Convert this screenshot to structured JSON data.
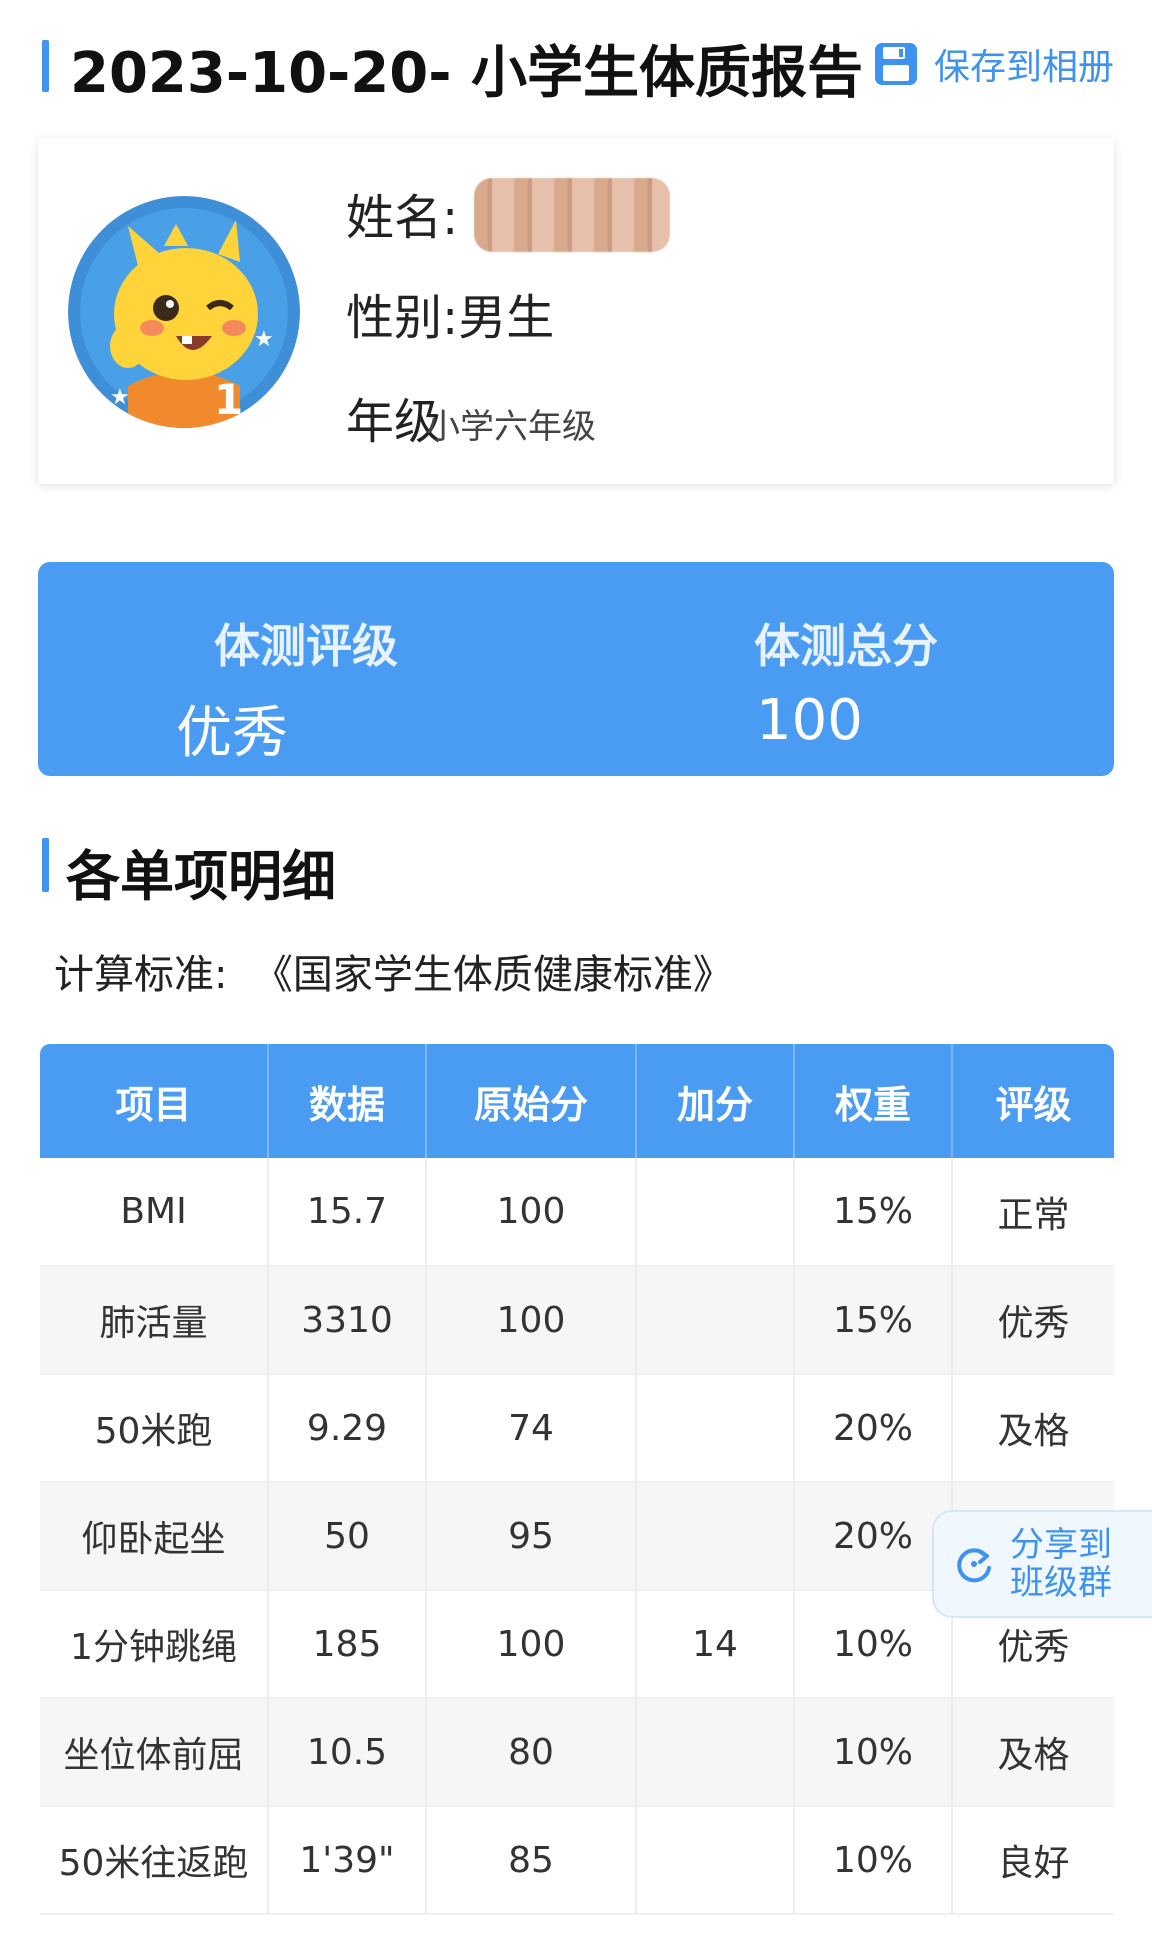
{
  "header": {
    "title": "2023-10-20- 小学生体质报告",
    "save_label": "保存到相册",
    "save_icon": "save-icon"
  },
  "profile": {
    "avatar_icon": "mascot-avatar",
    "name_label": "姓名:",
    "gender_label": "性别:",
    "gender_value": "男生",
    "grade_label": "年级",
    "grade_value": "小学六年级"
  },
  "score": {
    "rating_label": "体测评级",
    "rating_value": "优秀",
    "total_label": "体测总分",
    "total_value": "100"
  },
  "details": {
    "title": "各单项明细",
    "standard_label": "计算标准:",
    "standard_value": "《国家学生体质健康标准》",
    "columns": [
      "项目",
      "数据",
      "原始分",
      "加分",
      "权重",
      "评级"
    ],
    "rows": [
      [
        "BMI",
        "15.7",
        "100",
        "",
        "15%",
        "正常"
      ],
      [
        "肺活量",
        "3310",
        "100",
        "",
        "15%",
        "优秀"
      ],
      [
        "50米跑",
        "9.29",
        "74",
        "",
        "20%",
        "及格"
      ],
      [
        "仰卧起坐",
        "50",
        "95",
        "",
        "20%",
        ""
      ],
      [
        "1分钟跳绳",
        "185",
        "100",
        "14",
        "10%",
        "优秀"
      ],
      [
        "坐位体前屈",
        "10.5",
        "80",
        "",
        "10%",
        "及格"
      ],
      [
        "50米往返跑",
        "1'39\"",
        "85",
        "",
        "10%",
        "良好"
      ]
    ]
  },
  "share": {
    "label_line1": "分享到",
    "label_line2": "班级群",
    "icon": "share-refresh-icon"
  },
  "colors": {
    "accent": "#4a9cf2",
    "link": "#3d93ee"
  }
}
